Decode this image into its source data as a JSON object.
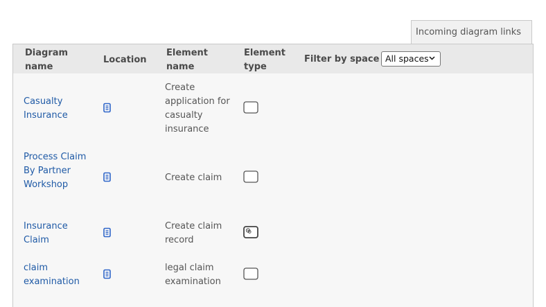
{
  "tab": {
    "label": "Incoming diagram links"
  },
  "table": {
    "headers": {
      "diagram_name": "Diagram name",
      "location": "Location",
      "element_name": "Element name",
      "element_type": "Element type",
      "filter_label": "Filter by space"
    },
    "filter": {
      "selected": "All spaces"
    },
    "rows": [
      {
        "diagram_name": "Casualty Insurance",
        "location_icon": "document-icon",
        "element_name": "Create application for casualty insurance",
        "element_type_icon": "task-icon"
      },
      {
        "diagram_name": "Process Claim By Partner Workshop",
        "location_icon": "document-icon",
        "element_name": "Create claim",
        "element_type_icon": "task-icon"
      },
      {
        "diagram_name": "Insurance Claim",
        "location_icon": "document-icon",
        "element_name": "Create claim record",
        "element_type_icon": "service-task-icon"
      },
      {
        "diagram_name": "claim examination",
        "location_icon": "document-icon",
        "element_name": "legal claim examination",
        "element_type_icon": "task-icon"
      }
    ]
  },
  "colors": {
    "link": "#1f5aa6",
    "icon_blue": "#2f66c9",
    "header_bg": "#e9e9e9",
    "panel_bg": "#f7f7f7"
  }
}
